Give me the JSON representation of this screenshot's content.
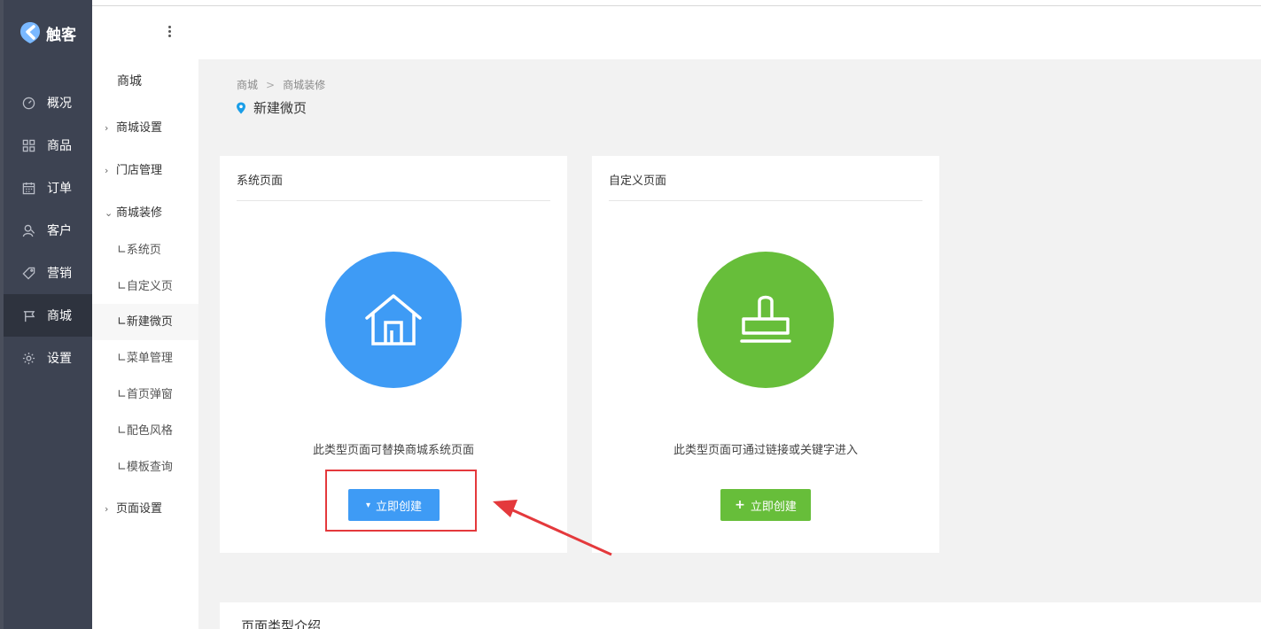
{
  "app": {
    "name": "触客"
  },
  "sidebar": {
    "items": [
      {
        "label": "概况",
        "icon": "dashboard-icon"
      },
      {
        "label": "商品",
        "icon": "grid-icon"
      },
      {
        "label": "订单",
        "icon": "calendar-icon"
      },
      {
        "label": "客户",
        "icon": "user-icon"
      },
      {
        "label": "营销",
        "icon": "tag-icon"
      },
      {
        "label": "商城",
        "icon": "flag-icon",
        "active": true
      },
      {
        "label": "设置",
        "icon": "gear-icon"
      }
    ]
  },
  "subnav": {
    "title": "商城",
    "groups": [
      {
        "label": "商城设置",
        "chevron": "›"
      },
      {
        "label": "门店管理",
        "chevron": "›"
      },
      {
        "label": "商城装修",
        "chevron": "⌄"
      },
      {
        "label": "页面设置",
        "chevron": "›"
      }
    ],
    "items": [
      {
        "label": "∟系统页"
      },
      {
        "label": "∟自定义页"
      },
      {
        "label": "∟新建微页",
        "current": true
      },
      {
        "label": "∟菜单管理"
      },
      {
        "label": "∟首页弹窗"
      },
      {
        "label": "∟配色风格"
      },
      {
        "label": "∟模板查询"
      }
    ]
  },
  "breadcrumb": {
    "items": [
      "商城",
      "商城装修"
    ],
    "separator": ">"
  },
  "page": {
    "title": "新建微页"
  },
  "cards": [
    {
      "title": "系统页面",
      "description": "此类型页面可替换商城系统页面",
      "button_label": "立即创建",
      "button_icon": "▾",
      "color": "#3e9bf5",
      "icon": "house-icon"
    },
    {
      "title": "自定义页面",
      "description": "此类型页面可通过链接或关键字进入",
      "button_label": "立即创建",
      "button_icon": "+",
      "color": "#67be3a",
      "icon": "stamp-icon"
    }
  ],
  "intro": {
    "title": "页面类型介绍"
  },
  "colors": {
    "sidebar": "#3d4352",
    "highlight": "#e4393c",
    "accent": "#1a9ee8"
  }
}
